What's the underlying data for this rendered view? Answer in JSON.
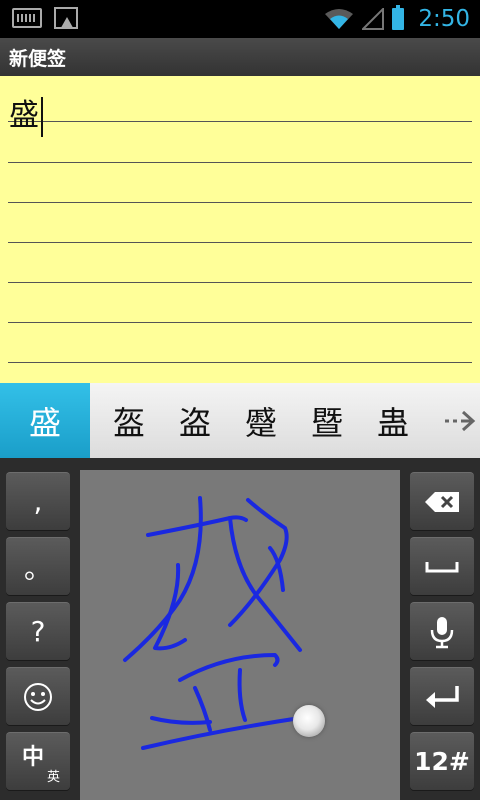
{
  "status_bar": {
    "time": "2:50",
    "icons": [
      "keyboard-icon",
      "image-icon",
      "wifi-icon",
      "signal-icon",
      "battery-icon"
    ],
    "accent_color": "#33b5e5"
  },
  "title_bar": {
    "title": "新便签"
  },
  "note": {
    "text": "盛"
  },
  "candidates": {
    "items": [
      "盛",
      "盔",
      "盗",
      "蹙",
      "暨",
      "蛊"
    ],
    "selected_index": 0,
    "more_icon": "arrow-right-icon"
  },
  "keyboard": {
    "left_keys": [
      ",",
      "。",
      "?",
      "smiley-icon",
      "中"
    ],
    "left_key_sub": "英",
    "right_keys": [
      "backspace-icon",
      "space-icon",
      "microphone-icon",
      "enter-icon",
      "12#"
    ],
    "handwriting_color": "#1a28e0"
  }
}
